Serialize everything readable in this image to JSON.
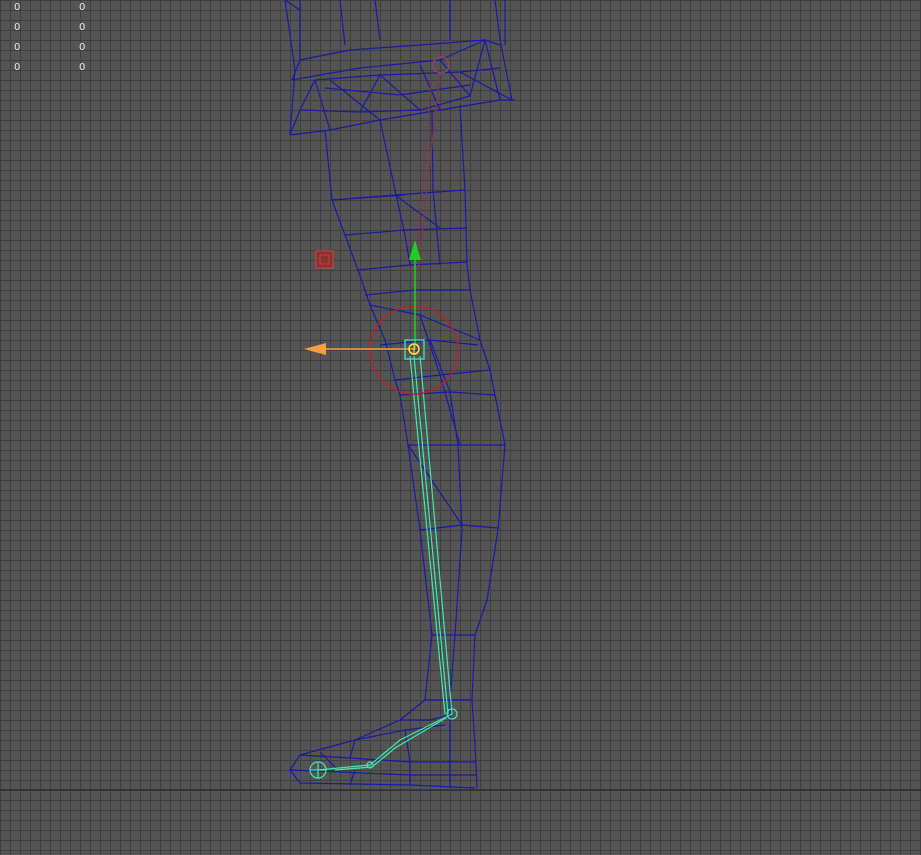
{
  "viewport": {
    "background": "#545454",
    "grid_color": "#3f3f3f",
    "horizon_color": "#2f2f2f"
  },
  "hud": {
    "rows": [
      {
        "a": "0",
        "b": "0"
      },
      {
        "a": "0",
        "b": "0"
      },
      {
        "a": "0",
        "b": "0"
      },
      {
        "a": "0",
        "b": "0"
      }
    ]
  },
  "colors": {
    "wireframe": "#1a1aa8",
    "joint": "#3ee8b0",
    "selected_joint": "#ffe14a",
    "manipulator_y": "#1fcf1f",
    "manipulator_x": "#f2a040",
    "rotate_ring": "#c02020",
    "pole_vector": "#c04040",
    "parent_bone": "#7a3a4a"
  },
  "icons": {
    "translate_y_handle": "green-arrow-icon",
    "translate_x_handle": "orange-arrow-icon",
    "pole_vector": "square-locator-icon",
    "hip_joint": "joint-circle-icon",
    "toe_joint": "joint-crosshair-icon"
  }
}
